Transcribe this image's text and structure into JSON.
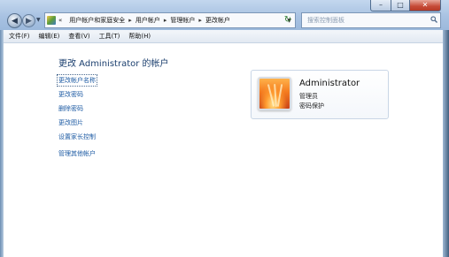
{
  "window": {
    "controls": {
      "minimize": "–",
      "maximize": "□",
      "close": "✕"
    }
  },
  "nav": {
    "back_glyph": "◀",
    "forward_glyph": "▶",
    "dropdown_glyph": "▼"
  },
  "addressbar": {
    "prefix": "«",
    "separator": "▸",
    "crumbs": [
      "用户帐户和家庭安全",
      "用户帐户",
      "管理帐户",
      "更改帐户"
    ],
    "dropdown_glyph": "▼",
    "refresh_glyph": "↻"
  },
  "search": {
    "placeholder": "搜索控制面板",
    "icon": "search-icon"
  },
  "menubar": {
    "items": [
      "文件(F)",
      "编辑(E)",
      "查看(V)",
      "工具(T)",
      "帮助(H)"
    ]
  },
  "main": {
    "heading": "更改 Administrator 的帐户",
    "tasks": [
      "更改帐户名称",
      "更改密码",
      "删除密码",
      "更改图片",
      "设置家长控制"
    ],
    "other_task": "管理其他帐户"
  },
  "account": {
    "name": "Administrator",
    "role": "管理员",
    "status": "密码保护"
  },
  "colors": {
    "heading": "#1b3f6e",
    "link": "#1c5aa3",
    "titlebar": "#a8c2e2"
  }
}
